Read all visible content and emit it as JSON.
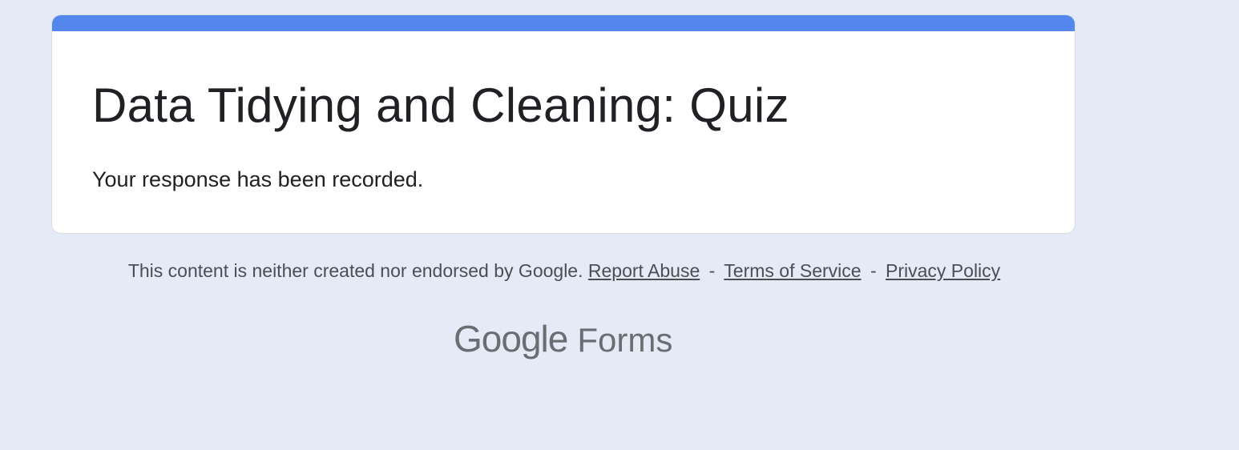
{
  "form": {
    "title": "Data Tidying and Cleaning: Quiz",
    "confirmation_message": "Your response has been recorded."
  },
  "footer": {
    "disclaimer": "This content is neither created nor endorsed by Google.",
    "separator": "-",
    "links": {
      "report_abuse": "Report Abuse",
      "terms_of_service": "Terms of Service",
      "privacy_policy": "Privacy Policy"
    }
  },
  "brand": {
    "logo_name": "Google",
    "product_name": "Forms"
  },
  "colors": {
    "page_background": "#e4ebf7",
    "accent": "#5487ee",
    "card_background": "#ffffff",
    "text_primary": "#202124",
    "text_secondary": "#4a4e55",
    "logo_gray": "#6a6d72"
  }
}
